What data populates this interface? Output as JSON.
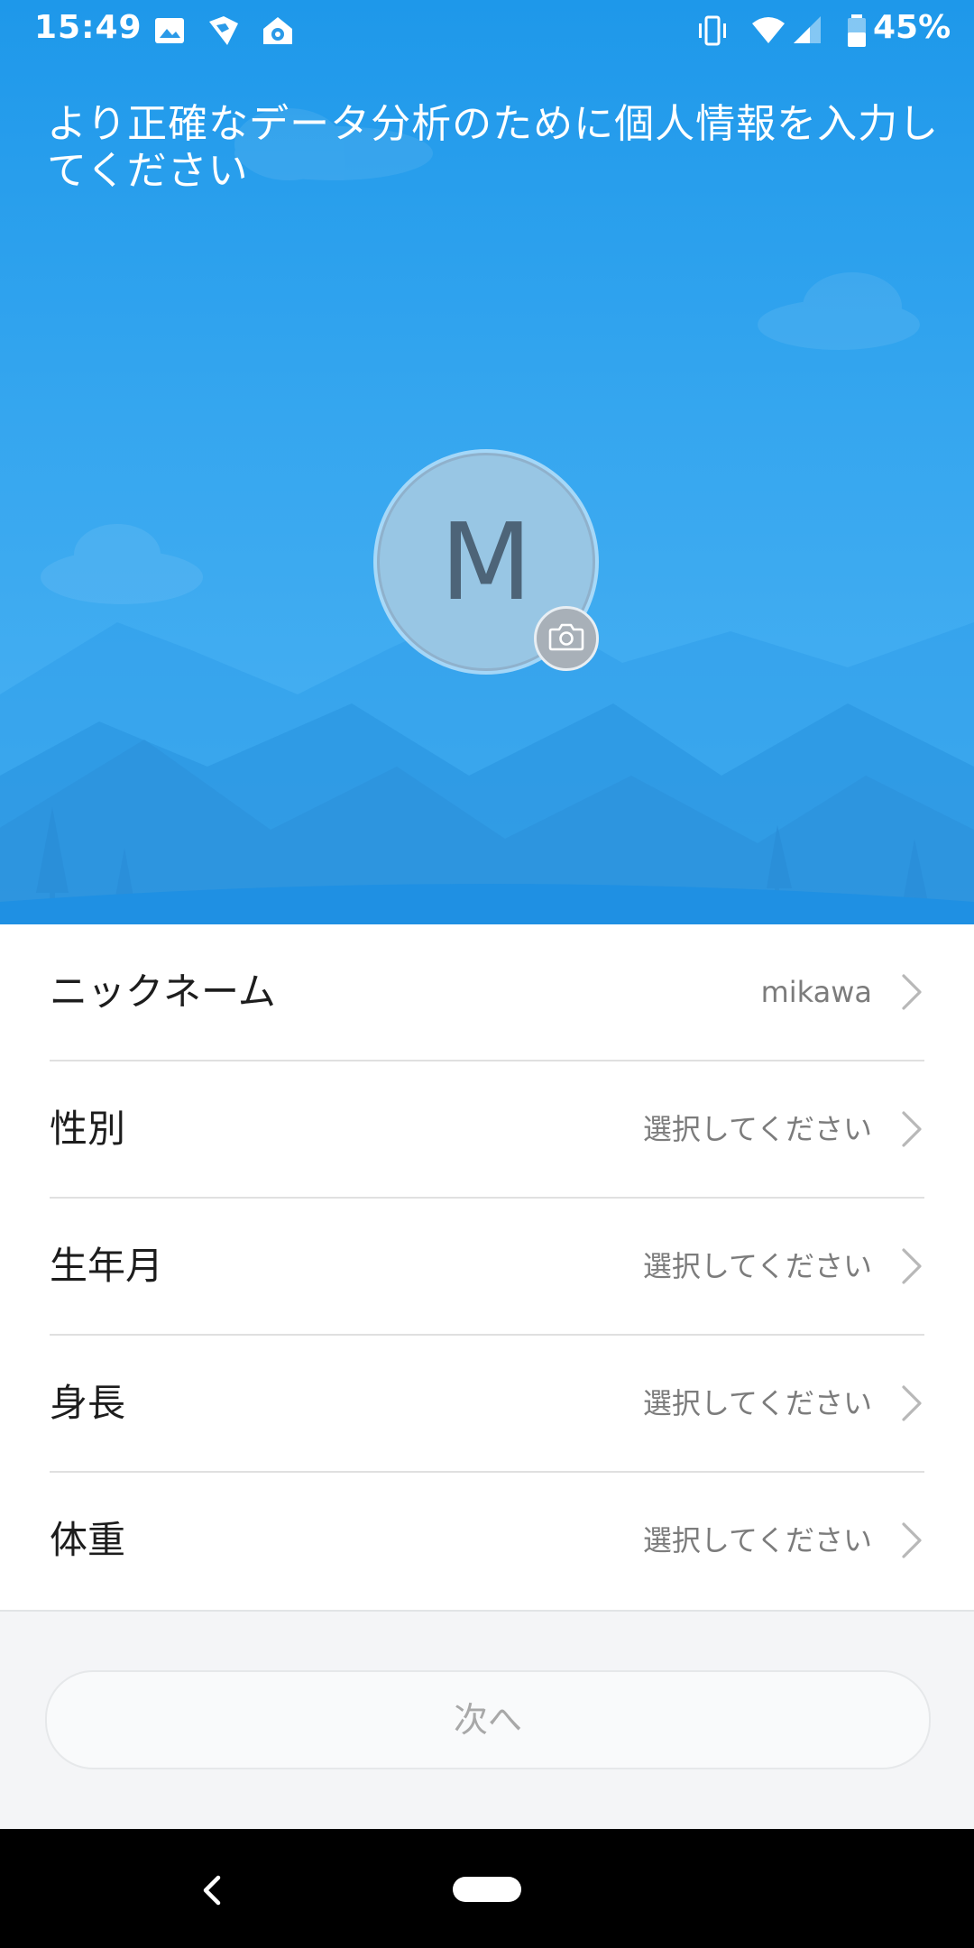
{
  "status_bar": {
    "time": "15:49",
    "battery": "45%",
    "icons": [
      "image-icon",
      "cast-icon",
      "home-icon",
      "vibrate-icon",
      "wifi-icon",
      "signal-icon",
      "battery-icon"
    ]
  },
  "header": {
    "title": "より正確なデータ分析のために個人情報を入力してください"
  },
  "avatar": {
    "initial": "M",
    "camera_icon": "camera-icon"
  },
  "profile_form": {
    "rows": [
      {
        "label": "ニックネーム",
        "value": "mikawa"
      },
      {
        "label": "性別",
        "value": "選択してください"
      },
      {
        "label": "生年月",
        "value": "選択してください"
      },
      {
        "label": "身長",
        "value": "選択してください"
      },
      {
        "label": "体重",
        "value": "選択してください"
      }
    ]
  },
  "actions": {
    "next_label": "次へ"
  },
  "nav_bar": {
    "icons": [
      "back-icon",
      "home-pill-icon"
    ]
  },
  "colors": {
    "hero_top": "#1e98ea",
    "hero_bottom": "#4db3f3",
    "avatar_fill": "#98c6e4",
    "next_text": "#a8a8a8"
  }
}
